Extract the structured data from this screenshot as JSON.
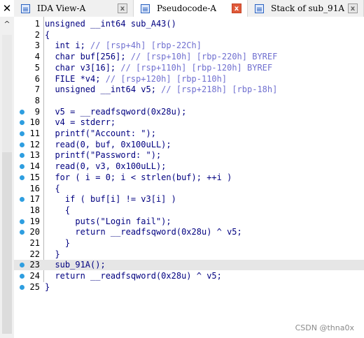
{
  "tabs": [
    {
      "label": "IDA View-A",
      "icon": "document-icon",
      "active": false
    },
    {
      "label": "Pseudocode-A",
      "icon": "document-icon",
      "active": true
    },
    {
      "label": "Stack of sub_91A",
      "icon": "struct-icon",
      "active": false
    }
  ],
  "close_glyph": "✕",
  "tab_close_glyph": "x",
  "scroll_up_glyph": "^",
  "lines": [
    {
      "n": "1",
      "bp": false,
      "hl": false,
      "code": "unsigned __int64 sub_A43()"
    },
    {
      "n": "2",
      "bp": false,
      "hl": false,
      "code": "{"
    },
    {
      "n": "3",
      "bp": false,
      "hl": false,
      "code": "  int i; // [rsp+4h] [rbp-22Ch]"
    },
    {
      "n": "4",
      "bp": false,
      "hl": false,
      "code": "  char buf[256]; // [rsp+10h] [rbp-220h] BYREF"
    },
    {
      "n": "5",
      "bp": false,
      "hl": false,
      "code": "  char v3[16]; // [rsp+110h] [rbp-120h] BYREF"
    },
    {
      "n": "6",
      "bp": false,
      "hl": false,
      "code": "  FILE *v4; // [rsp+120h] [rbp-110h]"
    },
    {
      "n": "7",
      "bp": false,
      "hl": false,
      "code": "  unsigned __int64 v5; // [rsp+218h] [rbp-18h]"
    },
    {
      "n": "8",
      "bp": false,
      "hl": false,
      "code": ""
    },
    {
      "n": "9",
      "bp": true,
      "hl": false,
      "code": "  v5 = __readfsqword(0x28u);"
    },
    {
      "n": "10",
      "bp": true,
      "hl": false,
      "code": "  v4 = stderr;"
    },
    {
      "n": "11",
      "bp": true,
      "hl": false,
      "code": "  printf(\"Account: \");"
    },
    {
      "n": "12",
      "bp": true,
      "hl": false,
      "code": "  read(0, buf, 0x100uLL);"
    },
    {
      "n": "13",
      "bp": true,
      "hl": false,
      "code": "  printf(\"Password: \");"
    },
    {
      "n": "14",
      "bp": true,
      "hl": false,
      "code": "  read(0, v3, 0x100uLL);"
    },
    {
      "n": "15",
      "bp": true,
      "hl": false,
      "code": "  for ( i = 0; i < strlen(buf); ++i )"
    },
    {
      "n": "16",
      "bp": false,
      "hl": false,
      "code": "  {"
    },
    {
      "n": "17",
      "bp": true,
      "hl": false,
      "code": "    if ( buf[i] != v3[i] )"
    },
    {
      "n": "18",
      "bp": false,
      "hl": false,
      "code": "    {"
    },
    {
      "n": "19",
      "bp": true,
      "hl": false,
      "code": "      puts(\"Login fail\");"
    },
    {
      "n": "20",
      "bp": true,
      "hl": false,
      "code": "      return __readfsqword(0x28u) ^ v5;"
    },
    {
      "n": "21",
      "bp": false,
      "hl": false,
      "code": "    }"
    },
    {
      "n": "22",
      "bp": false,
      "hl": false,
      "code": "  }"
    },
    {
      "n": "23",
      "bp": true,
      "hl": true,
      "code": "  sub_91A();"
    },
    {
      "n": "24",
      "bp": true,
      "hl": false,
      "code": "  return __readfsqword(0x28u) ^ v5;"
    },
    {
      "n": "25",
      "bp": true,
      "hl": false,
      "code": "}"
    }
  ],
  "watermark": "CSDN @thna0x"
}
